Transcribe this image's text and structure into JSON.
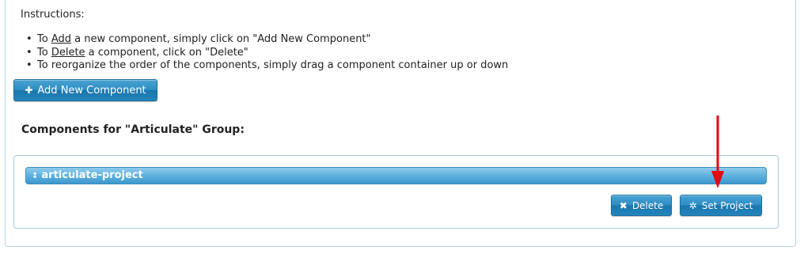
{
  "instructions": {
    "title": "Instructions:",
    "items": [
      {
        "pre": "To ",
        "u": "Add",
        "post": " a new component, simply click on \"Add New Component\""
      },
      {
        "pre": "To ",
        "u": "Delete",
        "post": " a component, click on \"Delete\""
      },
      {
        "pre": "",
        "u": "",
        "post": "To reorganize the order of the components, simply drag a component container up or down"
      }
    ]
  },
  "add_button": {
    "icon": "plus-icon",
    "label": "Add New Component"
  },
  "components_heading": "Components for \"Articulate\" Group:",
  "component": {
    "drag_icon": "drag-handle-icon",
    "name": "articulate-project"
  },
  "actions": {
    "delete": {
      "icon": "close-icon",
      "label": "Delete"
    },
    "set_project": {
      "icon": "gear-icon",
      "label": "Set Project"
    }
  },
  "colors": {
    "button_blue": "#2d8cc2",
    "bar_blue": "#5fb1de",
    "arrow_red": "#e30613",
    "border": "#b9d1e2"
  }
}
